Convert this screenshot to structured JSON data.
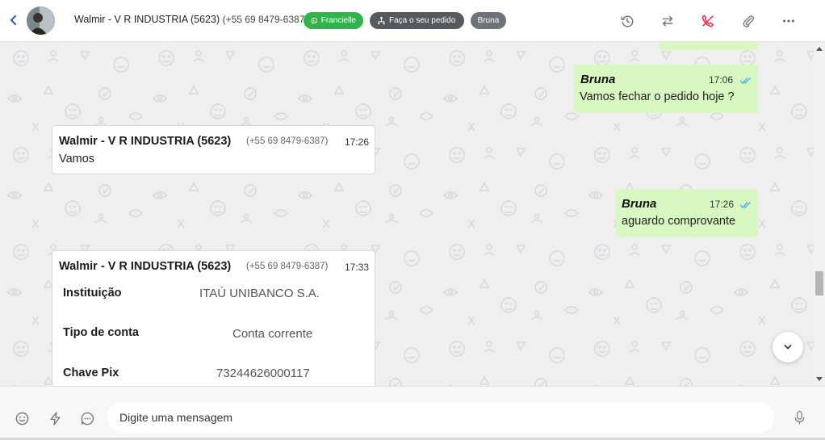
{
  "header": {
    "contact_name": "Walmir - V R INDUSTRIA (5623)",
    "contact_phone": "(+55 69 8479-6387)",
    "tags": [
      {
        "label": "Francielle",
        "icon": "whatsapp-icon",
        "color": "#2fb44a"
      },
      {
        "label": "Faça o seu pedido",
        "icon": "flow-icon",
        "color": "#555a5e"
      },
      {
        "label": "Bruna",
        "color": "#6d7378"
      }
    ],
    "actions": [
      "history-icon",
      "transfer-icon",
      "end-call-icon",
      "attach-icon",
      "more-icon"
    ]
  },
  "messages": [
    {
      "direction": "out",
      "sender": "Bruna",
      "time": "17:06",
      "text": "Vamos fechar o pedido hoje ?"
    },
    {
      "direction": "in",
      "sender": "Walmir - V R INDUSTRIA (5623)",
      "phone": "(+55 69 8479-6387)",
      "time": "17:26",
      "text": "Vamos"
    },
    {
      "direction": "out",
      "sender": "Bruna",
      "time": "17:26",
      "text": "aguardo comprovante"
    },
    {
      "direction": "in",
      "sender": "Walmir - V R INDUSTRIA (5623)",
      "phone": "(+55 69 8479-6387)",
      "time": "17:33",
      "fields": [
        {
          "label": "Instituição",
          "value": "ITAÚ UNIBANCO S.A."
        },
        {
          "label": "Tipo de conta",
          "value": "Conta corrente"
        },
        {
          "label": "Chave Pix",
          "value": "73244626000117"
        }
      ]
    }
  ],
  "composer": {
    "placeholder": "Digite uma mensagem",
    "icons": [
      "emoji-icon",
      "quick-reply-icon",
      "chat-options-icon",
      "microphone-icon"
    ]
  },
  "colors": {
    "accent": "#2a5ca8",
    "outgoing_bubble": "#d9f7c0",
    "tag_green": "#2fb44a",
    "end_call": "#e0284a"
  }
}
